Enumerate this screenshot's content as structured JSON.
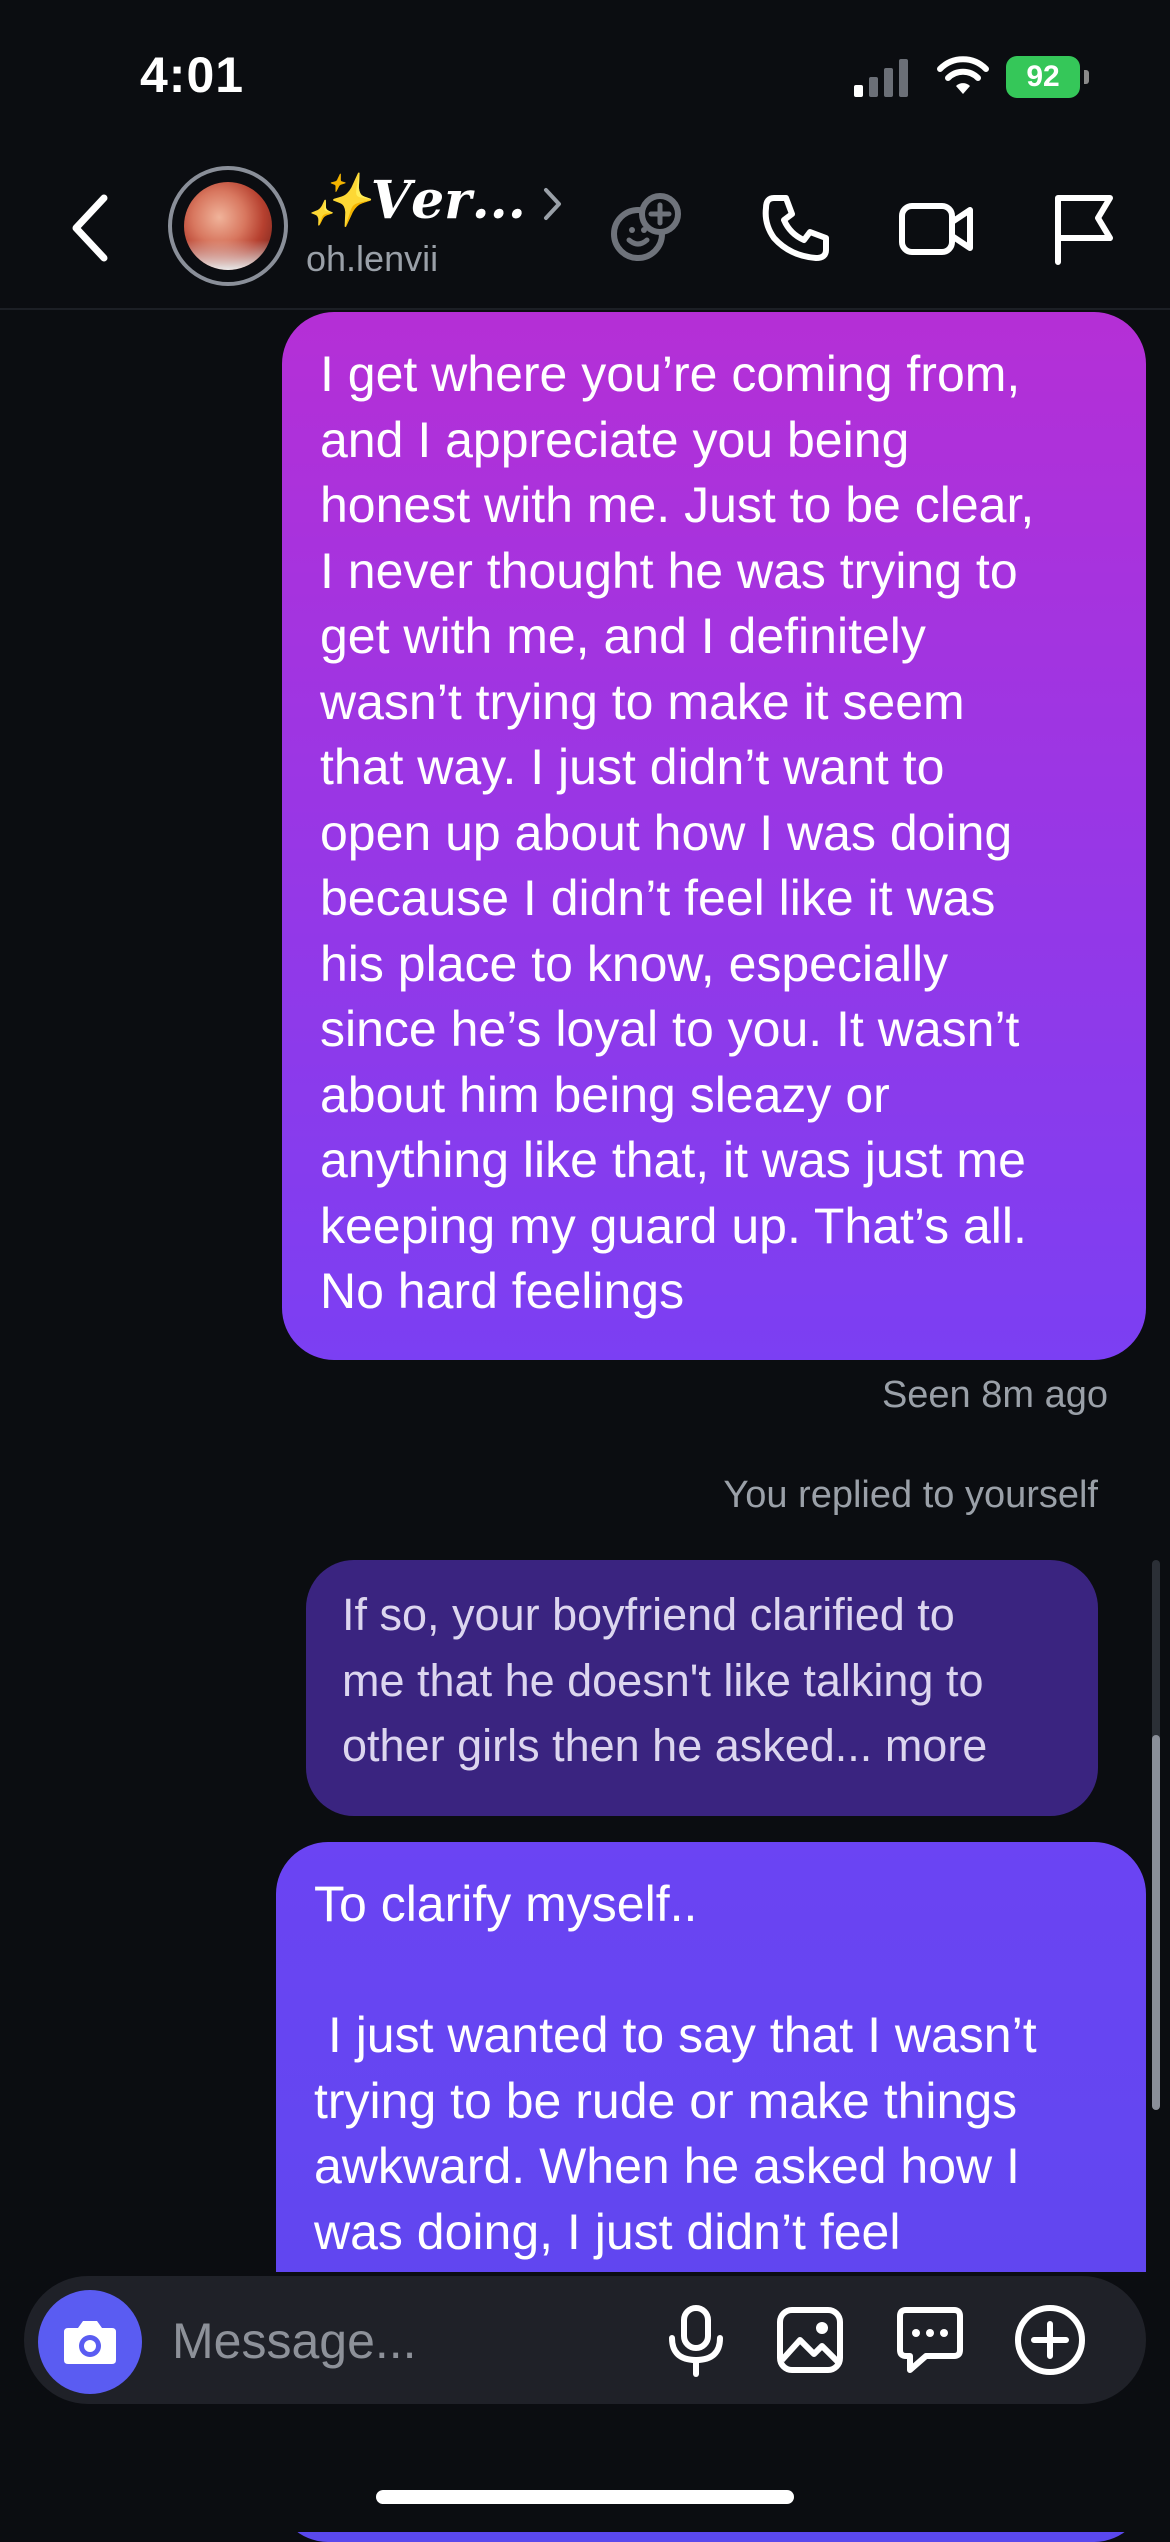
{
  "status_bar": {
    "time": "4:01",
    "battery": "92",
    "battery_color": "#35c759"
  },
  "header": {
    "contact_name": "✨𝑽𝒆𝒓...",
    "contact_handle": "oh.lenvii",
    "icons": [
      "back-icon",
      "effects-icon",
      "phone-icon",
      "video-camera-icon",
      "flag-icon"
    ]
  },
  "messages": [
    {
      "sender": "me",
      "text": "I get where you’re coming from,\nand I appreciate you being\nhonest with me. Just to be clear,\nI never thought he was trying to\nget with me, and I definitely\nwasn’t trying to make it seem\nthat way. I just didn’t want to\nopen up about how I was doing\nbecause I didn’t feel like it was\nhis place to know, especially\nsince he’s loyal to you. It wasn’t\nabout him being sleazy or\nanything like that, it was just me\nkeeping my guard up. That’s all.\nNo hard feelings"
    }
  ],
  "seen_label": "Seen 8m ago",
  "replied_label": "You replied to yourself",
  "reply_preview": {
    "text": "If so, your boyfriend clarified to\nme that he doesn't like talking to\nother girls then he asked... more"
  },
  "message_2": {
    "text": "To clarify myself..\n\n I just wanted to say that I wasn’t\ntrying to be rude or make things\nawkward. When he asked how I\nwas doing, I just didn’t feel"
  },
  "composer": {
    "placeholder": "Message...",
    "accent": "#5a5cf2",
    "icons": [
      "camera-icon",
      "microphone-icon",
      "gallery-icon",
      "sticker-icon",
      "plus-icon"
    ]
  },
  "colors": {
    "background": "#0b0d11",
    "bubble_gradient_top": "#b52fd6",
    "bubble_gradient_bottom": "#7b3ff3",
    "reply_bubble": "#3a2480",
    "second_bubble": "#6b44f3"
  }
}
